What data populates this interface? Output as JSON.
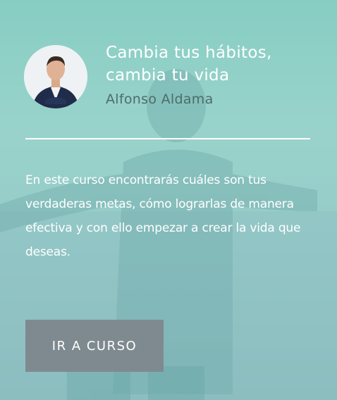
{
  "course": {
    "title_line1": "Cambia tus hábitos,",
    "title_line2": "cambia tu vida",
    "author": "Alfonso Aldama",
    "description": "En este curso encontrarás cuáles son tus verdaderas metas, cómo lograrlas de manera efectiva y con ello empezar a crear la vida que deseas.",
    "cta_label": "IR A CURSO"
  },
  "colors": {
    "background_tint": "#8fd0c6",
    "author_text": "#4e6b6a",
    "button_bg": "#7f8a90"
  }
}
